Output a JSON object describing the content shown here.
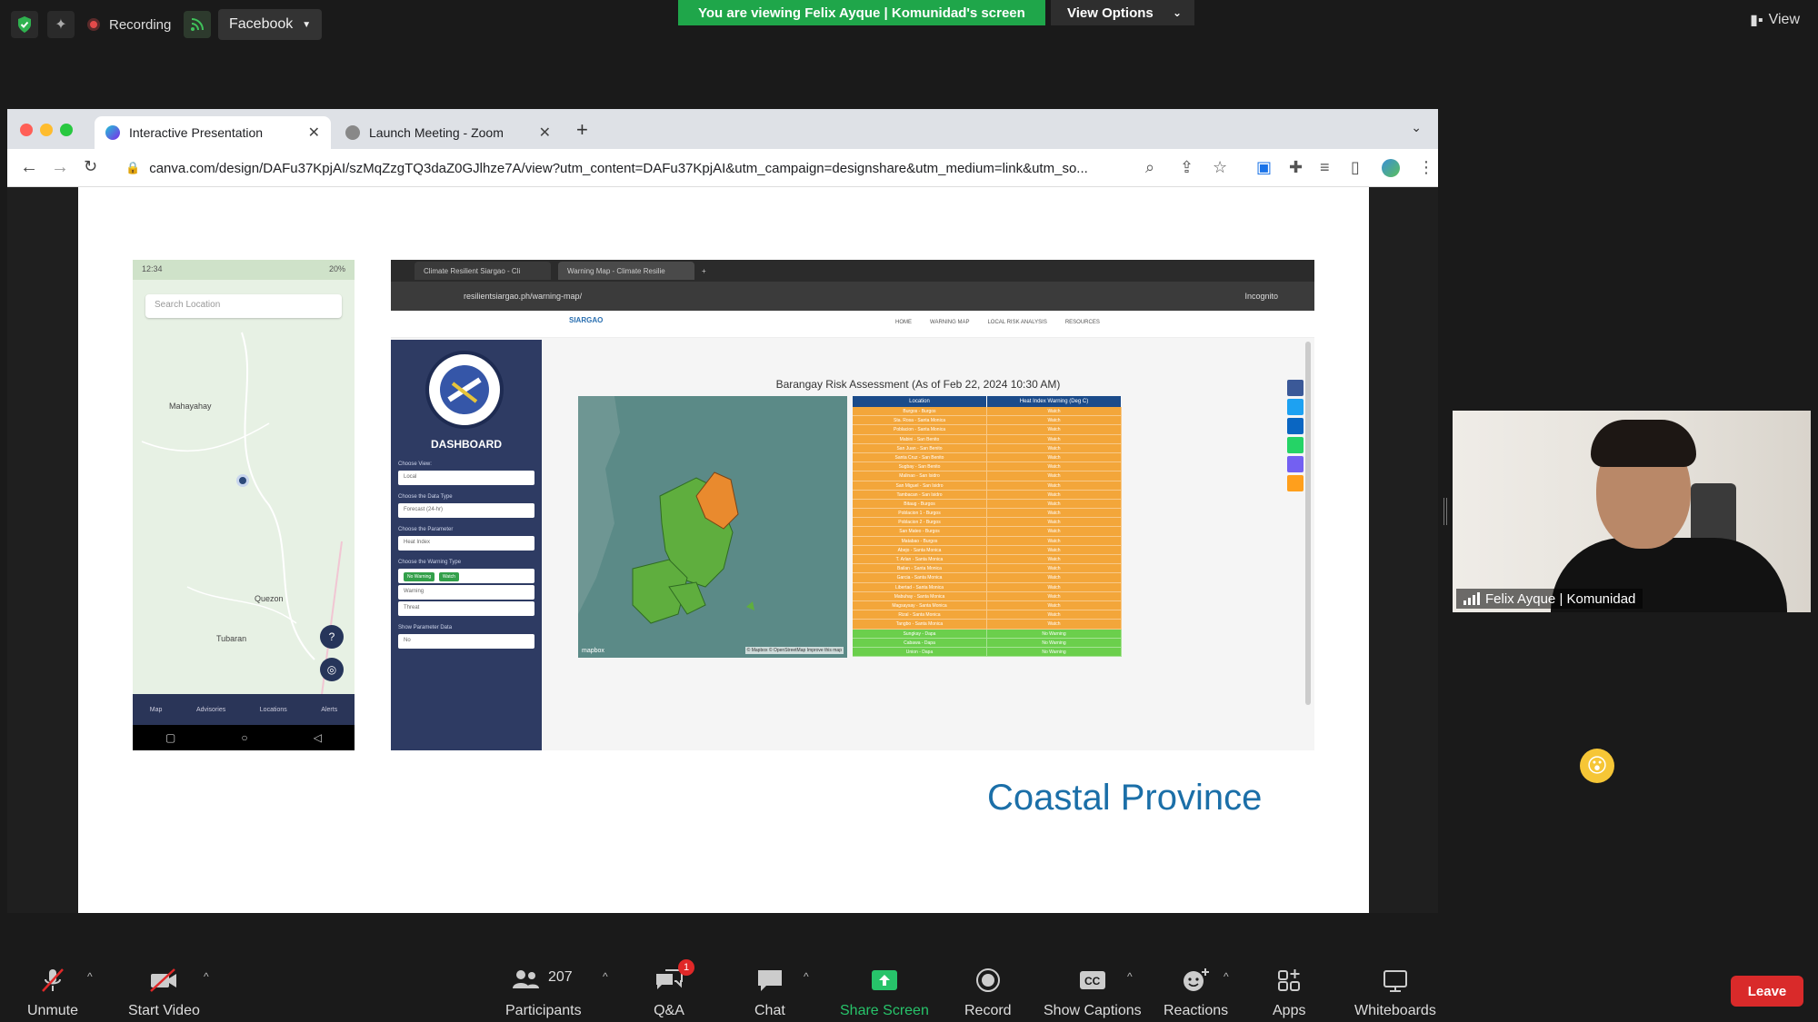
{
  "top": {
    "recording": "Recording",
    "facebook": "Facebook",
    "banner": "You are viewing Felix Ayque | Komunidad's screen",
    "view_options": "View Options",
    "view": "View"
  },
  "browser": {
    "tabs": [
      {
        "title": "Interactive Presentation"
      },
      {
        "title": "Launch Meeting - Zoom"
      }
    ],
    "url": "canva.com/design/DAFu37KpjAI/szMqZzgTQ3daZ0GJlhze7A/view?utm_content=DAFu37KpjAI&utm_campaign=designshare&utm_medium=link&utm_so..."
  },
  "slide": {
    "phone": {
      "status_time": "12:34",
      "status_right": "20%",
      "search_placeholder": "Search Location",
      "places": [
        "Mahayahay",
        "Quezon",
        "Tubaran"
      ],
      "nav": [
        "Map",
        "Advisories",
        "Locations",
        "Alerts"
      ]
    },
    "embed": {
      "tabs": [
        "Climate Resilient Siargao - Cli",
        "Warning Map - Climate Resilie"
      ],
      "url": "resilientsiargao.ph/warning-map/",
      "incognito": "Incognito",
      "logo": "SIARGAO",
      "menu": [
        "HOME",
        "WARNING MAP",
        "LOCAL RISK ANALYSIS",
        "RESOURCES"
      ],
      "dashboard": {
        "title": "DASHBOARD",
        "fields": [
          {
            "label": "Choose View:",
            "value": "Local"
          },
          {
            "label": "Choose the Data Type",
            "value": "Forecast (24-hr)"
          },
          {
            "label": "Choose the Parameter",
            "value": "Heat Index"
          },
          {
            "label": "Choose the Warning Type",
            "value": ""
          },
          {
            "label": "",
            "value": "Warning"
          },
          {
            "label": "",
            "value": "Threat"
          },
          {
            "label": "Show Parameter Data",
            "value": "No"
          }
        ],
        "chips": [
          "No Warning",
          "Watch"
        ]
      },
      "risk_title": "Barangay Risk Assessment (As of Feb 22, 2024 10:30 AM)",
      "table_headers": [
        "Location",
        "Heat Index Warning (Deg C)"
      ],
      "rows_watch": [
        "Burgos - Burgos",
        "Sta. Rosa - Santa Monica",
        "Poblacion - Santa Monica",
        "Mabini - San Benito",
        "San Juan - San Benito",
        "Santa Cruz - San Benito",
        "Sugbay - San Benito",
        "Malinao - San Isidro",
        "San Miguel - San Isidro",
        "Tambacan - San Isidro",
        "Bitaug - Burgos",
        "Poblacion 1 - Burgos",
        "Poblacion 2 - Burgos",
        "San Mateo - Burgos",
        "Matabao - Burgos",
        "Abejo - Santa Monica",
        "T. Arlan - Santa Monica",
        "Bailan - Santa Monica",
        "Garcia - Santa Monica",
        "Libertad - Santa Monica",
        "Mabuhay - Santa Monica",
        "Magsaysay - Santa Monica",
        "Rizal - Santa Monica",
        "Tangbo - Santa Monica"
      ],
      "rows_none": [
        "Sungkay - Dapa",
        "Cabawa - Dapa",
        "Union - Dapa"
      ],
      "watch_label": "Watch",
      "none_label": "No Warning",
      "map_attr": "mapbox",
      "map_attr2": "© Mapbox © OpenStreetMap Improve this map"
    },
    "caption": "Coastal Province"
  },
  "participant": {
    "name": "Felix Ayque | Komunidad"
  },
  "bottom": {
    "unmute": "Unmute",
    "start_video": "Start Video",
    "participants": "Participants",
    "participants_count": "207",
    "qa": "Q&A",
    "qa_badge": "1",
    "chat": "Chat",
    "share_screen": "Share Screen",
    "record": "Record",
    "show_captions": "Show Captions",
    "reactions": "Reactions",
    "apps": "Apps",
    "whiteboards": "Whiteboards",
    "leave": "Leave"
  },
  "colors": {
    "banner": "#1fa64a",
    "watch": "#f3a63a",
    "no_warning": "#6bcf4c",
    "leave": "#d92a2a",
    "caption": "#1b6fa8"
  }
}
